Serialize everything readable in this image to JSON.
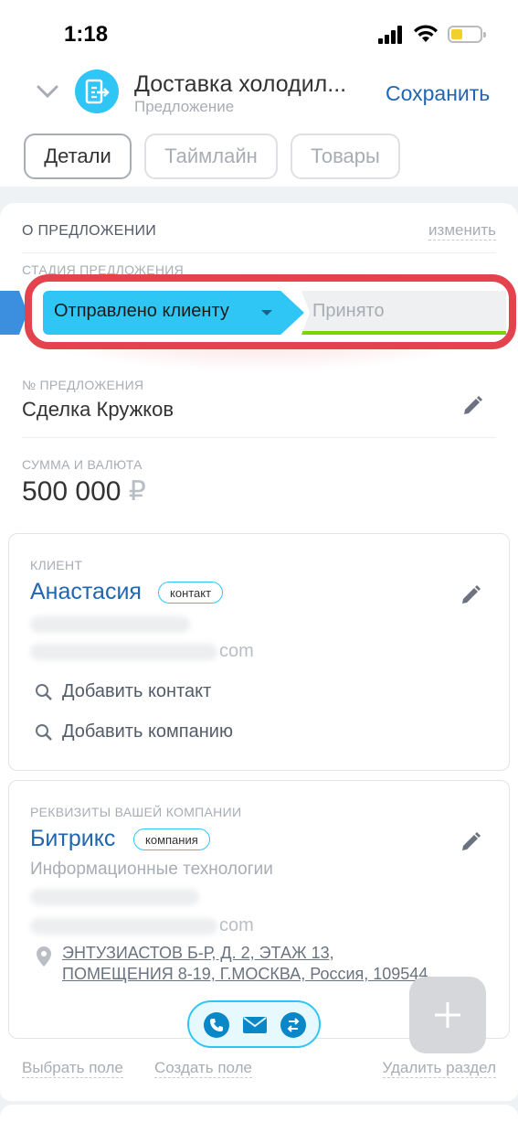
{
  "status_bar": {
    "time": "1:18"
  },
  "header": {
    "title": "Доставка холодил...",
    "subtitle": "Предложение",
    "save_label": "Сохранить"
  },
  "tabs": [
    {
      "label": "Детали",
      "active": true
    },
    {
      "label": "Таймлайн",
      "active": false
    },
    {
      "label": "Товары",
      "active": false
    }
  ],
  "about": {
    "title": "О ПРЕДЛОЖЕНИИ",
    "edit_label": "изменить",
    "stage_label": "СТАДИЯ ПРЕДЛОЖЕНИЯ",
    "current_stage": "Отправлено клиенту",
    "next_stage": "Принято",
    "number_label": "№ ПРЕДЛОЖЕНИЯ",
    "number_value": "Сделка Кружков",
    "amount_label": "СУММА И ВАЛЮТА",
    "amount_value": "500 000",
    "currency": "₽"
  },
  "client": {
    "label": "КЛИЕНТ",
    "name": "Анастасия",
    "badge": "контакт",
    "email_suffix": "com",
    "add_contact": "Добавить контакт",
    "add_company": "Добавить компанию"
  },
  "company": {
    "label": "РЕКВИЗИТЫ ВАШЕЙ КОМПАНИИ",
    "name": "Битрикс",
    "badge": "компания",
    "industry": "Информационные технологии",
    "email_suffix": "com",
    "address": "ЭНТУЗИАСТОВ Б-Р, Д. 2, ЭТАЖ 13, ПОМЕЩЕНИЯ 8-19, Г.МОСКВА, Россия, 109544"
  },
  "footer": {
    "choose_field": "Выбрать поле",
    "create_field": "Создать поле",
    "delete_section": "Удалить раздел"
  },
  "colors": {
    "accent": "#2066b0",
    "stage_current": "#2fc6f6",
    "stage_next_bar": "#7bd500",
    "highlight": "#e4424d"
  },
  "icons": [
    "chevron-down-icon",
    "document-exit-icon",
    "pencil-icon",
    "search-icon",
    "location-pin-icon",
    "phone-icon",
    "mail-icon",
    "transfer-icon",
    "plus-icon"
  ]
}
